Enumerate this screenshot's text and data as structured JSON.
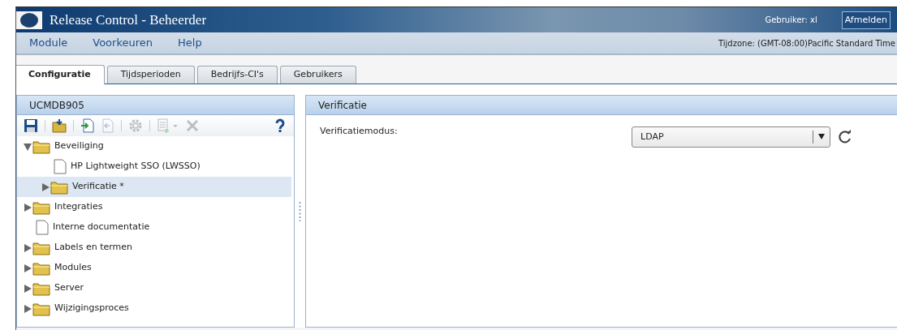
{
  "window": {
    "title": "Release Control - Beheerder",
    "user": "Gebruiker: xl",
    "logout": "Afmelden"
  },
  "menu": [
    "Module",
    "Voorkeuren",
    "Help"
  ],
  "timezone": "Tijdzone: (GMT-08:00)Pacific Standard Time",
  "tabs": [
    {
      "label": "Configuratie",
      "selected": true
    },
    {
      "label": "Tijdsperioden",
      "selected": false
    },
    {
      "label": "Bedrijfs-CI's",
      "selected": false
    },
    {
      "label": "Gebruikers",
      "selected": false
    }
  ],
  "left_panel": {
    "title": "UCMDB905",
    "tools": [
      {
        "kind": "save",
        "disabled": false
      },
      {
        "kind": "sep"
      },
      {
        "kind": "folder-import",
        "disabled": false
      },
      {
        "kind": "sep"
      },
      {
        "kind": "doc-import",
        "disabled": false
      },
      {
        "kind": "doc-export",
        "disabled": true
      },
      {
        "kind": "sep"
      },
      {
        "kind": "gear",
        "disabled": true
      },
      {
        "kind": "sep"
      },
      {
        "kind": "list-add",
        "disabled": true
      },
      {
        "kind": "delete",
        "disabled": true
      },
      {
        "kind": "help",
        "disabled": false
      }
    ],
    "tree": [
      {
        "label": "Beveiliging",
        "kind": "folder",
        "expanded": true,
        "selected": false,
        "children": [
          {
            "label": "HP Lightweight SSO (LWSSO)",
            "kind": "document",
            "selected": false
          },
          {
            "label": "Verificatie *",
            "kind": "folder",
            "expanded": false,
            "selected": true
          }
        ]
      },
      {
        "label": "Integraties",
        "kind": "folder",
        "expanded": false,
        "selected": false
      },
      {
        "label": "Interne documentatie",
        "kind": "document",
        "selected": false
      },
      {
        "label": "Labels en termen",
        "kind": "folder",
        "expanded": false,
        "selected": false
      },
      {
        "label": "Modules",
        "kind": "folder",
        "expanded": false,
        "selected": false
      },
      {
        "label": "Server",
        "kind": "folder",
        "expanded": false,
        "selected": false
      },
      {
        "label": "Wijzigingsproces",
        "kind": "folder",
        "expanded": false,
        "selected": false
      }
    ]
  },
  "right_panel": {
    "title": "Verificatie",
    "field": {
      "label": "Verificatiemodus:",
      "value": "LDAP"
    }
  }
}
